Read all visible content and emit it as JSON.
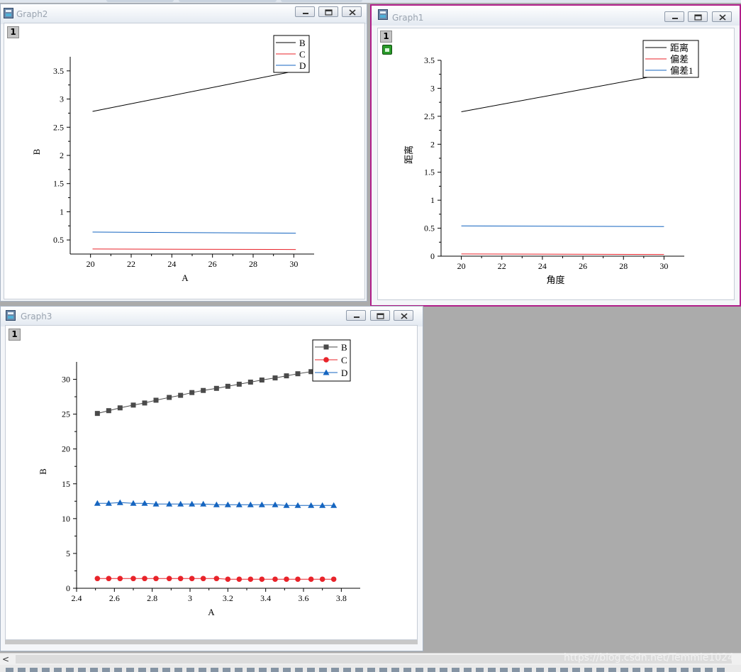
{
  "windows": {
    "graph2": {
      "title": "Graph2",
      "layer_label": "1",
      "chart": {
        "xlabel": "A",
        "ylabel": "B",
        "x_ticks": [
          "20",
          "22",
          "24",
          "26",
          "28",
          "30"
        ],
        "y_ticks": [
          "0.5",
          "1",
          "1.5",
          "2",
          "2.5",
          "3",
          "3.5"
        ],
        "legend": [
          "B",
          "C",
          "D"
        ]
      }
    },
    "graph1": {
      "title": "Graph1",
      "layer_label": "1",
      "chart": {
        "xlabel": "角度",
        "ylabel": "距离",
        "x_ticks": [
          "20",
          "22",
          "24",
          "26",
          "28",
          "30"
        ],
        "y_ticks": [
          "0",
          "0.5",
          "1",
          "1.5",
          "2",
          "2.5",
          "3",
          "3.5"
        ],
        "legend": [
          "距离",
          "偏差",
          "偏差1"
        ]
      }
    },
    "graph3": {
      "title": "Graph3",
      "layer_label": "1",
      "chart": {
        "xlabel": "A",
        "ylabel": "B",
        "x_ticks": [
          "2.4",
          "2.6",
          "2.8",
          "3",
          "3.2",
          "3.4",
          "3.6",
          "3.8"
        ],
        "y_ticks": [
          "0",
          "5",
          "10",
          "15",
          "20",
          "25",
          "30"
        ],
        "legend": [
          "B",
          "C",
          "D"
        ]
      }
    }
  },
  "watermark": "https://blog.csdn.net/Temmie1024",
  "scroll_arrow": "<",
  "colors": {
    "black_series": "#000000",
    "red_series": "#e8232a",
    "blue_series": "#1565c0",
    "active_border": "#b11e8a"
  },
  "chart_data": [
    {
      "type": "line",
      "xlim": [
        19,
        31
      ],
      "ylim": [
        0.25,
        3.75
      ],
      "x": [
        20.1,
        30.1
      ],
      "series": [
        {
          "name": "B",
          "color": "#000000",
          "values": [
            2.78,
            3.5
          ]
        },
        {
          "name": "C",
          "color": "#e8232a",
          "values": [
            0.34,
            0.33
          ]
        },
        {
          "name": "D",
          "color": "#1565c0",
          "values": [
            0.64,
            0.62
          ]
        }
      ]
    },
    {
      "type": "line",
      "xlim": [
        19,
        31
      ],
      "ylim": [
        0,
        3.5
      ],
      "x": [
        20,
        30
      ],
      "series": [
        {
          "name": "距离",
          "color": "#000000",
          "values": [
            2.58,
            3.25
          ]
        },
        {
          "name": "偏差",
          "color": "#e8232a",
          "values": [
            0.04,
            0.03
          ]
        },
        {
          "name": "偏差1",
          "color": "#1565c0",
          "values": [
            0.54,
            0.53
          ]
        }
      ]
    },
    {
      "type": "line",
      "xlim": [
        2.4,
        3.9
      ],
      "ylim": [
        0,
        32.5
      ],
      "x": [
        2.51,
        2.57,
        2.63,
        2.7,
        2.76,
        2.82,
        2.89,
        2.95,
        3.01,
        3.07,
        3.14,
        3.2,
        3.26,
        3.32,
        3.38,
        3.45,
        3.51,
        3.57,
        3.64,
        3.7,
        3.76
      ],
      "series": [
        {
          "name": "B",
          "color": "#4a4a4a",
          "marker": "square",
          "values": [
            25.1,
            25.5,
            25.9,
            26.3,
            26.6,
            27.0,
            27.4,
            27.7,
            28.1,
            28.4,
            28.7,
            29.0,
            29.3,
            29.6,
            29.9,
            30.2,
            30.5,
            30.8,
            31.1,
            31.4,
            31.7
          ]
        },
        {
          "name": "C",
          "color": "#e8232a",
          "marker": "circle",
          "values": [
            1.4,
            1.4,
            1.4,
            1.4,
            1.4,
            1.4,
            1.4,
            1.4,
            1.4,
            1.4,
            1.4,
            1.3,
            1.3,
            1.3,
            1.3,
            1.3,
            1.3,
            1.3,
            1.3,
            1.3,
            1.3
          ]
        },
        {
          "name": "D",
          "color": "#1565c0",
          "marker": "triangle",
          "values": [
            12.2,
            12.2,
            12.3,
            12.2,
            12.2,
            12.1,
            12.1,
            12.1,
            12.1,
            12.1,
            12.0,
            12.0,
            12.0,
            12.0,
            12.0,
            12.0,
            11.9,
            11.9,
            11.9,
            11.9,
            11.9
          ]
        }
      ]
    }
  ]
}
